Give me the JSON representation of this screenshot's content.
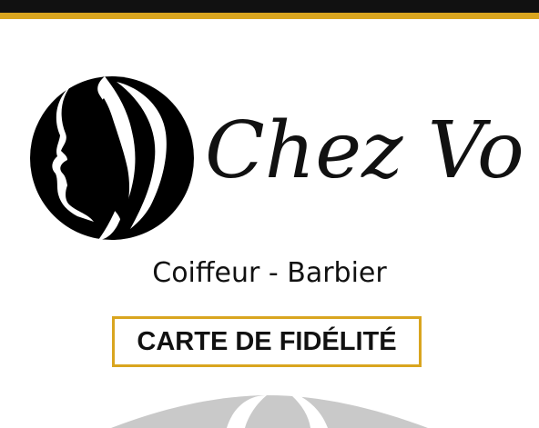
{
  "brand": {
    "name": "Chez Vous",
    "subtitle": "Coiffeur - Barbier",
    "card_label": "CARTE DE FIDÉLITÉ"
  },
  "colors": {
    "black": "#111111",
    "gold": "#d9a51f",
    "gray": "#c9c9c9",
    "white": "#ffffff"
  },
  "icons": {
    "logo": "profile-faces-logo-icon",
    "bottom": "scissors-gray-icon"
  }
}
